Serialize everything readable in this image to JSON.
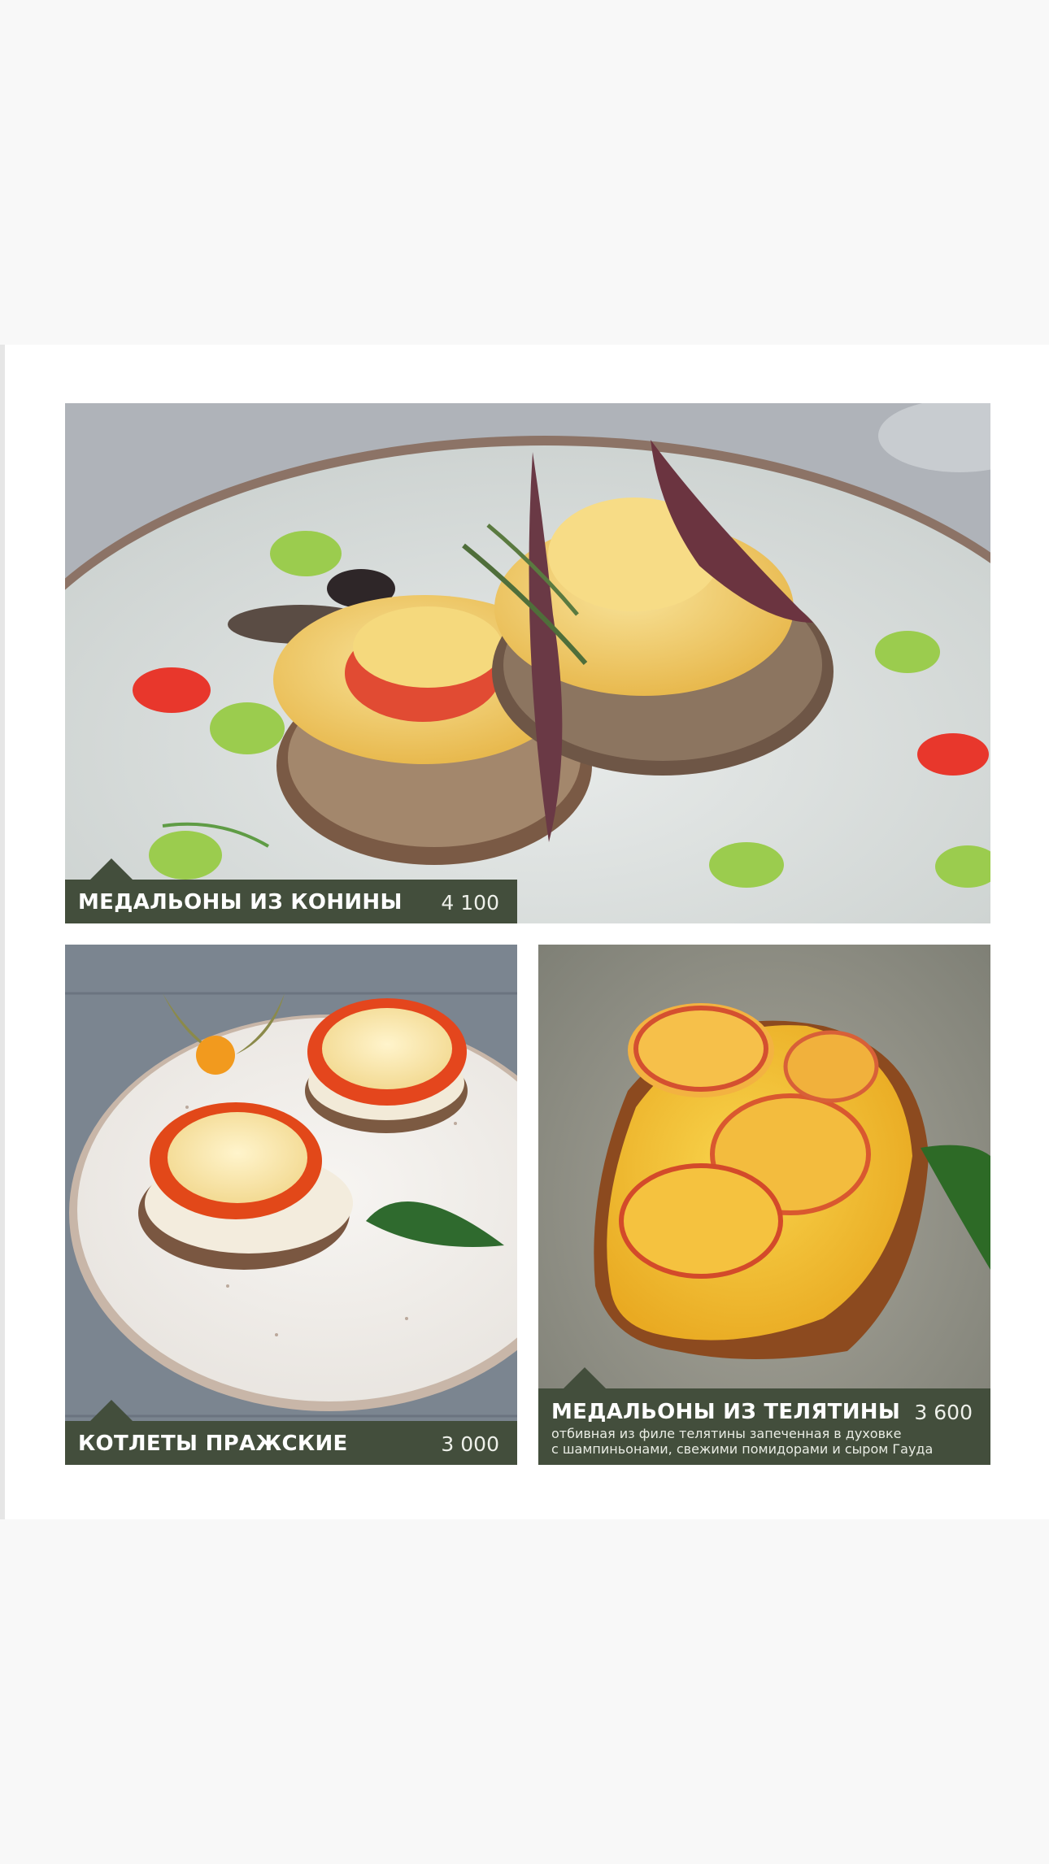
{
  "menu": {
    "items": [
      {
        "name": "МЕДАЛЬОНЫ ИЗ КОНИНЫ",
        "price": "4 100",
        "image": "horse-meat-medallions-photo"
      },
      {
        "name": "КОТЛЕТЫ ПРАЖСКИЕ",
        "price": "3 000",
        "image": "prague-cutlets-photo"
      },
      {
        "name": "МЕДАЛЬОНЫ ИЗ ТЕЛЯТИНЫ",
        "price": "3 600",
        "description_line1": "отбивная из филе телятины  запеченная в духовке",
        "description_line2": "с шампиньонами, свежими помидорами и сыром Гауда",
        "image": "veal-medallions-photo"
      }
    ]
  },
  "colors": {
    "label_bar": "#434e3c",
    "page_background": "#f8f8f8",
    "card_background": "#ffffff"
  }
}
